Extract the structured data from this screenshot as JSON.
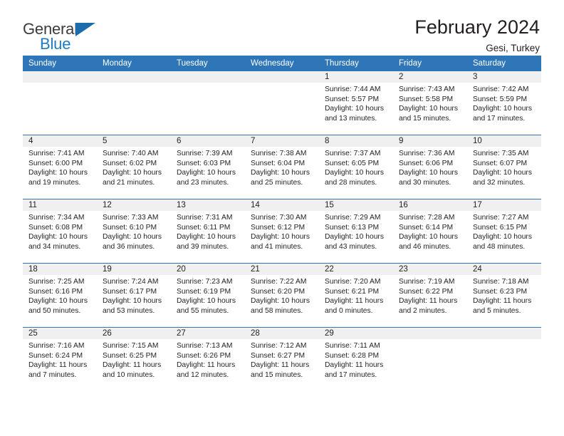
{
  "brand": {
    "name_part1": "General",
    "name_part2": "Blue",
    "accent_color": "#1f7bc1",
    "triangle_color": "#1b6cab"
  },
  "header": {
    "title": "February 2024",
    "subtitle": "Gesi, Turkey",
    "header_bar_color": "#2e76b8"
  },
  "weekdays": [
    "Sunday",
    "Monday",
    "Tuesday",
    "Wednesday",
    "Thursday",
    "Friday",
    "Saturday"
  ],
  "weeks": [
    [
      {
        "day": "",
        "empty": true
      },
      {
        "day": "",
        "empty": true
      },
      {
        "day": "",
        "empty": true
      },
      {
        "day": "",
        "empty": true
      },
      {
        "day": "1",
        "sunrise": "Sunrise: 7:44 AM",
        "sunset": "Sunset: 5:57 PM",
        "daylight": "Daylight: 10 hours and 13 minutes."
      },
      {
        "day": "2",
        "sunrise": "Sunrise: 7:43 AM",
        "sunset": "Sunset: 5:58 PM",
        "daylight": "Daylight: 10 hours and 15 minutes."
      },
      {
        "day": "3",
        "sunrise": "Sunrise: 7:42 AM",
        "sunset": "Sunset: 5:59 PM",
        "daylight": "Daylight: 10 hours and 17 minutes."
      }
    ],
    [
      {
        "day": "4",
        "sunrise": "Sunrise: 7:41 AM",
        "sunset": "Sunset: 6:00 PM",
        "daylight": "Daylight: 10 hours and 19 minutes."
      },
      {
        "day": "5",
        "sunrise": "Sunrise: 7:40 AM",
        "sunset": "Sunset: 6:02 PM",
        "daylight": "Daylight: 10 hours and 21 minutes."
      },
      {
        "day": "6",
        "sunrise": "Sunrise: 7:39 AM",
        "sunset": "Sunset: 6:03 PM",
        "daylight": "Daylight: 10 hours and 23 minutes."
      },
      {
        "day": "7",
        "sunrise": "Sunrise: 7:38 AM",
        "sunset": "Sunset: 6:04 PM",
        "daylight": "Daylight: 10 hours and 25 minutes."
      },
      {
        "day": "8",
        "sunrise": "Sunrise: 7:37 AM",
        "sunset": "Sunset: 6:05 PM",
        "daylight": "Daylight: 10 hours and 28 minutes."
      },
      {
        "day": "9",
        "sunrise": "Sunrise: 7:36 AM",
        "sunset": "Sunset: 6:06 PM",
        "daylight": "Daylight: 10 hours and 30 minutes."
      },
      {
        "day": "10",
        "sunrise": "Sunrise: 7:35 AM",
        "sunset": "Sunset: 6:07 PM",
        "daylight": "Daylight: 10 hours and 32 minutes."
      }
    ],
    [
      {
        "day": "11",
        "sunrise": "Sunrise: 7:34 AM",
        "sunset": "Sunset: 6:08 PM",
        "daylight": "Daylight: 10 hours and 34 minutes."
      },
      {
        "day": "12",
        "sunrise": "Sunrise: 7:33 AM",
        "sunset": "Sunset: 6:10 PM",
        "daylight": "Daylight: 10 hours and 36 minutes."
      },
      {
        "day": "13",
        "sunrise": "Sunrise: 7:31 AM",
        "sunset": "Sunset: 6:11 PM",
        "daylight": "Daylight: 10 hours and 39 minutes."
      },
      {
        "day": "14",
        "sunrise": "Sunrise: 7:30 AM",
        "sunset": "Sunset: 6:12 PM",
        "daylight": "Daylight: 10 hours and 41 minutes."
      },
      {
        "day": "15",
        "sunrise": "Sunrise: 7:29 AM",
        "sunset": "Sunset: 6:13 PM",
        "daylight": "Daylight: 10 hours and 43 minutes."
      },
      {
        "day": "16",
        "sunrise": "Sunrise: 7:28 AM",
        "sunset": "Sunset: 6:14 PM",
        "daylight": "Daylight: 10 hours and 46 minutes."
      },
      {
        "day": "17",
        "sunrise": "Sunrise: 7:27 AM",
        "sunset": "Sunset: 6:15 PM",
        "daylight": "Daylight: 10 hours and 48 minutes."
      }
    ],
    [
      {
        "day": "18",
        "sunrise": "Sunrise: 7:25 AM",
        "sunset": "Sunset: 6:16 PM",
        "daylight": "Daylight: 10 hours and 50 minutes."
      },
      {
        "day": "19",
        "sunrise": "Sunrise: 7:24 AM",
        "sunset": "Sunset: 6:17 PM",
        "daylight": "Daylight: 10 hours and 53 minutes."
      },
      {
        "day": "20",
        "sunrise": "Sunrise: 7:23 AM",
        "sunset": "Sunset: 6:19 PM",
        "daylight": "Daylight: 10 hours and 55 minutes."
      },
      {
        "day": "21",
        "sunrise": "Sunrise: 7:22 AM",
        "sunset": "Sunset: 6:20 PM",
        "daylight": "Daylight: 10 hours and 58 minutes."
      },
      {
        "day": "22",
        "sunrise": "Sunrise: 7:20 AM",
        "sunset": "Sunset: 6:21 PM",
        "daylight": "Daylight: 11 hours and 0 minutes."
      },
      {
        "day": "23",
        "sunrise": "Sunrise: 7:19 AM",
        "sunset": "Sunset: 6:22 PM",
        "daylight": "Daylight: 11 hours and 2 minutes."
      },
      {
        "day": "24",
        "sunrise": "Sunrise: 7:18 AM",
        "sunset": "Sunset: 6:23 PM",
        "daylight": "Daylight: 11 hours and 5 minutes."
      }
    ],
    [
      {
        "day": "25",
        "sunrise": "Sunrise: 7:16 AM",
        "sunset": "Sunset: 6:24 PM",
        "daylight": "Daylight: 11 hours and 7 minutes."
      },
      {
        "day": "26",
        "sunrise": "Sunrise: 7:15 AM",
        "sunset": "Sunset: 6:25 PM",
        "daylight": "Daylight: 11 hours and 10 minutes."
      },
      {
        "day": "27",
        "sunrise": "Sunrise: 7:13 AM",
        "sunset": "Sunset: 6:26 PM",
        "daylight": "Daylight: 11 hours and 12 minutes."
      },
      {
        "day": "28",
        "sunrise": "Sunrise: 7:12 AM",
        "sunset": "Sunset: 6:27 PM",
        "daylight": "Daylight: 11 hours and 15 minutes."
      },
      {
        "day": "29",
        "sunrise": "Sunrise: 7:11 AM",
        "sunset": "Sunset: 6:28 PM",
        "daylight": "Daylight: 11 hours and 17 minutes."
      },
      {
        "day": "",
        "empty": true
      },
      {
        "day": "",
        "empty": true
      }
    ]
  ]
}
